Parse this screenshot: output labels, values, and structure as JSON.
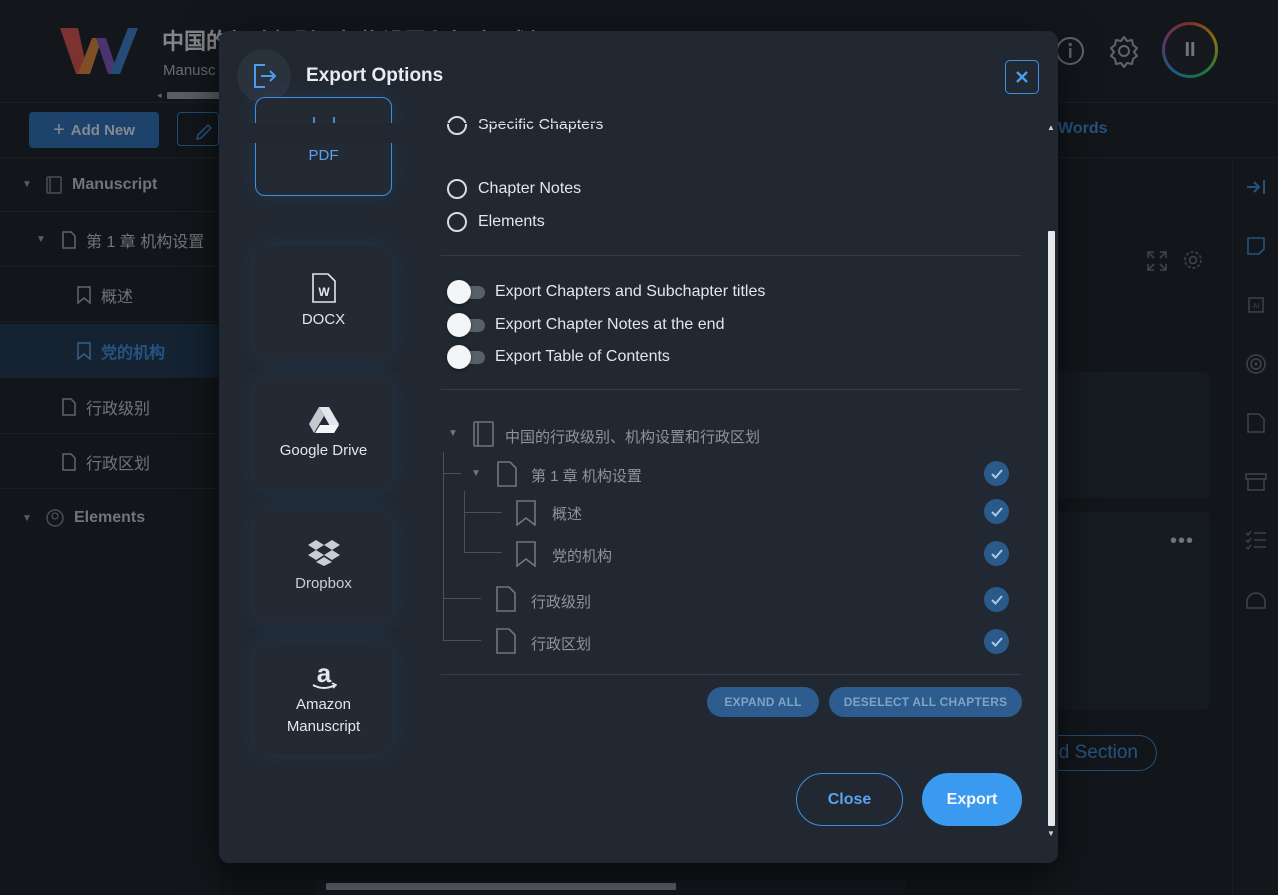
{
  "app": {
    "title": "中国的行政级别、机构设置和行政区划",
    "subtitle": "Manusc",
    "add_new_label": "Add New",
    "words_label": "Words",
    "add_section_label": "d Section",
    "avatar_glyph": "II"
  },
  "sidebar": {
    "items": [
      {
        "label": "Manuscript"
      },
      {
        "label": "第 1 章 机构设置"
      },
      {
        "label": "概述"
      },
      {
        "label": "党的机构"
      },
      {
        "label": "行政级别"
      },
      {
        "label": "行政区划"
      },
      {
        "label": "Elements"
      }
    ]
  },
  "modal": {
    "title": "Export Options",
    "formats": [
      {
        "label": "PDF",
        "selected": true
      },
      {
        "label": "DOCX",
        "selected": false
      },
      {
        "label": "Google Drive",
        "selected": false
      },
      {
        "label": "Dropbox",
        "selected": false
      },
      {
        "label": "Amazon\nManuscript",
        "selected": false
      }
    ],
    "radios": [
      {
        "label": "Specific Chapters"
      },
      {
        "label": "Chapter Notes"
      },
      {
        "label": "Elements"
      }
    ],
    "toggles": [
      {
        "label": "Export Chapters and Subchapter titles",
        "on": false
      },
      {
        "label": "Export Chapter Notes at the end",
        "on": false
      },
      {
        "label": "Export Table of Contents",
        "on": false
      }
    ],
    "tree": {
      "root": "中国的行政级别、机构设置和行政区划",
      "chapter": "第 1 章 机构设置",
      "sub1": "概述",
      "sub2": "党的机构",
      "ch2": "行政级别",
      "ch3": "行政区划"
    },
    "expand_all": "EXPAND ALL",
    "deselect_all": "DESELECT ALL CHAPTERS",
    "close_label": "Close",
    "export_label": "Export"
  },
  "colors": {
    "accent": "#3a9af0",
    "modal_bg": "#212831",
    "page_bg": "#181c22"
  }
}
